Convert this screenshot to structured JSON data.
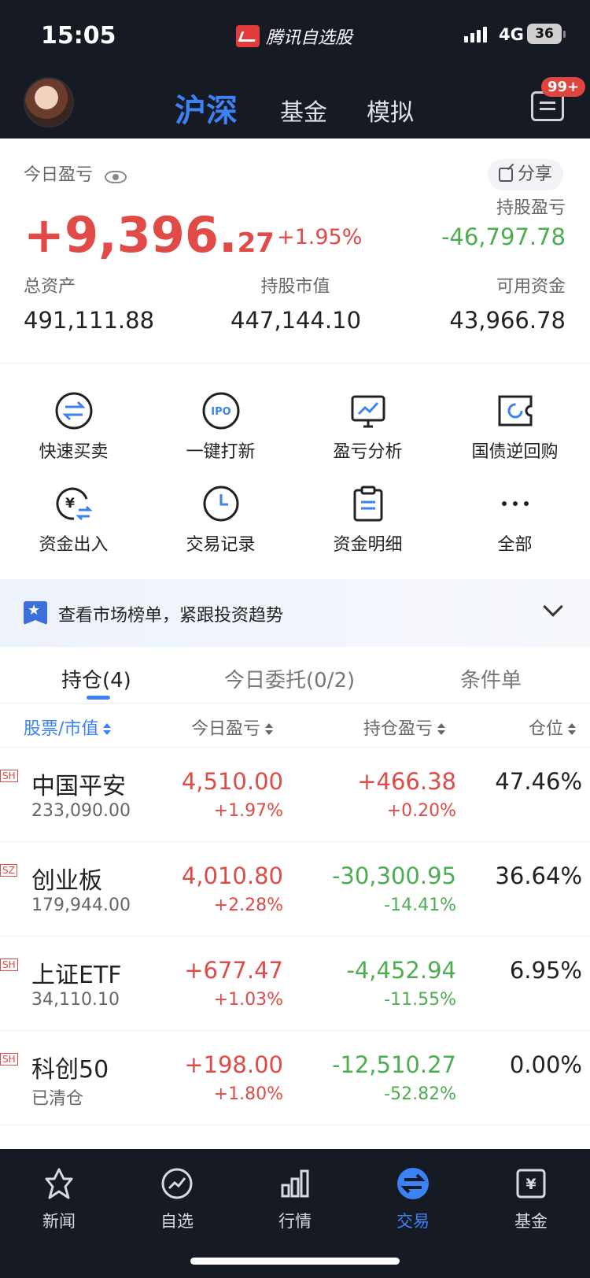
{
  "status_bar": {
    "time": "15:05",
    "app_name": "腾讯自选股",
    "network": "4G",
    "battery": "36"
  },
  "top_nav": {
    "tabs": [
      "沪深",
      "基金",
      "模拟"
    ],
    "active_tab": "沪深",
    "message_badge": "99+"
  },
  "summary": {
    "today_pnl_label": "今日盈亏",
    "share_label": "分享",
    "today_pnl_int": "+9,396.",
    "today_pnl_dec": "27",
    "today_pnl_pct": "+1.95%",
    "holding_pnl_label": "持股盈亏",
    "holding_pnl": "-46,797.78",
    "total_assets_label": "总资产",
    "total_assets": "491,111.88",
    "market_value_label": "持股市值",
    "market_value": "447,144.10",
    "available_label": "可用资金",
    "available": "43,966.78"
  },
  "quick_actions": [
    {
      "label": "快速买卖",
      "icon": "swap-icon"
    },
    {
      "label": "一键打新",
      "icon": "ipo-icon"
    },
    {
      "label": "盈亏分析",
      "icon": "chart-monitor-icon"
    },
    {
      "label": "国债逆回购",
      "icon": "refresh-ticket-icon"
    },
    {
      "label": "资金出入",
      "icon": "yen-transfer-icon"
    },
    {
      "label": "交易记录",
      "icon": "clock-icon"
    },
    {
      "label": "资金明细",
      "icon": "clipboard-icon"
    },
    {
      "label": "全部",
      "icon": "more-icon"
    }
  ],
  "banner": {
    "text": "查看市场榜单，紧跟投资趋势"
  },
  "position_tabs": [
    "持仓(4)",
    "今日委托(0/2)",
    "条件单"
  ],
  "table_headers": [
    "股票/市值",
    "今日盈亏",
    "持仓盈亏",
    "仓位"
  ],
  "positions": [
    {
      "market": "SH",
      "name": "中国平安",
      "sub": "233,090.00",
      "today": "4,510.00",
      "today_pct": "+1.97%",
      "hold": "+466.38",
      "hold_pct": "+0.20%",
      "weight": "47.46%"
    },
    {
      "market": "SZ",
      "name": "创业板",
      "sub": "179,944.00",
      "today": "4,010.80",
      "today_pct": "+2.28%",
      "hold": "-30,300.95",
      "hold_pct": "-14.41%",
      "weight": "36.64%"
    },
    {
      "market": "SH",
      "name": "上证ETF",
      "sub": "34,110.10",
      "today": "+677.47",
      "today_pct": "+1.03%",
      "hold": "-4,452.94",
      "hold_pct": "-11.55%",
      "weight": "6.95%"
    },
    {
      "market": "SH",
      "name": "科创50",
      "sub": "已清仓",
      "today": "+198.00",
      "today_pct": "+1.80%",
      "hold": "-12,510.27",
      "hold_pct": "-52.82%",
      "weight": "0.00%"
    }
  ],
  "bottom_tabs": [
    "新闻",
    "自选",
    "行情",
    "交易",
    "基金"
  ],
  "active_bottom_tab": "交易",
  "colors": {
    "up": "#e04a47",
    "down": "#4cae51",
    "accent": "#3b82f6",
    "dark_bg": "#161a23"
  }
}
